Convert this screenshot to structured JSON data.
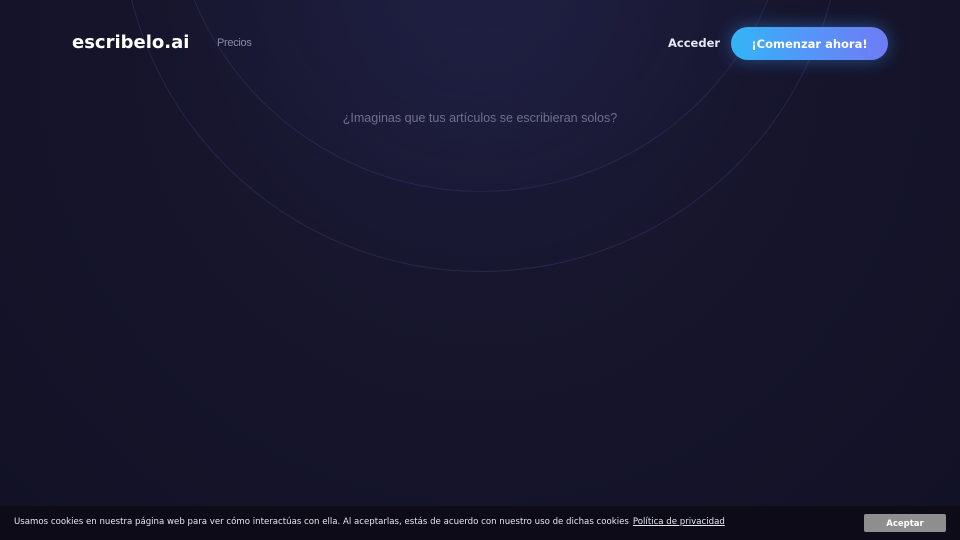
{
  "header": {
    "logo": "escribelo.ai",
    "nav": {
      "pricing": "Precios"
    },
    "login": "Acceder",
    "cta": "¡Comenzar ahora!"
  },
  "hero": {
    "tagline": "¿Imaginas que tus artículos se escribieran solos?"
  },
  "cookie_banner": {
    "message": "Usamos cookies en nuestra página web para ver cómo interactúas con ella. Al aceptarlas, estás de acuerdo con nuestro uso de dichas cookies",
    "privacy_link": "Política de privacidad",
    "accept": "Aceptar"
  },
  "colors": {
    "background": "#15142a",
    "cta_gradient_start": "#33b4f6",
    "cta_gradient_end": "#6f7cf5",
    "cookie_bar": "#0c0b17",
    "accept_button": "#8e8e8e"
  }
}
